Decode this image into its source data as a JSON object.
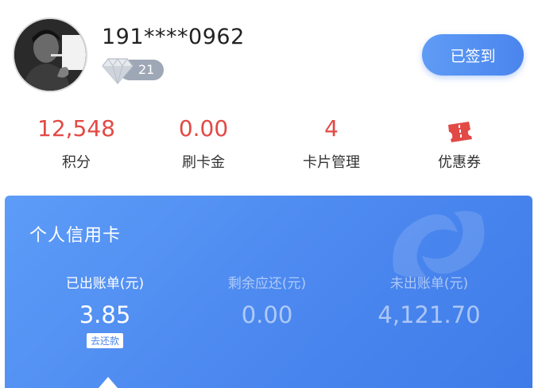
{
  "profile": {
    "phone": "191****0962",
    "level": "21",
    "signin_label": "已签到"
  },
  "stats": [
    {
      "value": "12,548",
      "label": "积分"
    },
    {
      "value": "0.00",
      "label": "刷卡金"
    },
    {
      "value": "4",
      "label": "卡片管理"
    },
    {
      "icon": "coupon-icon",
      "label": "优惠券"
    }
  ],
  "card": {
    "title": "个人信用卡",
    "bills": [
      {
        "label": "已出账单(元)",
        "value": "3.85",
        "action": "去还款"
      },
      {
        "label": "剩余应还(元)",
        "value": "0.00"
      },
      {
        "label": "未出账单(元)",
        "value": "4,121.70"
      }
    ]
  },
  "colors": {
    "accent_red": "#e24a45",
    "card_blue": "#4a86ee",
    "signin_blue": "#5f9cf5"
  }
}
